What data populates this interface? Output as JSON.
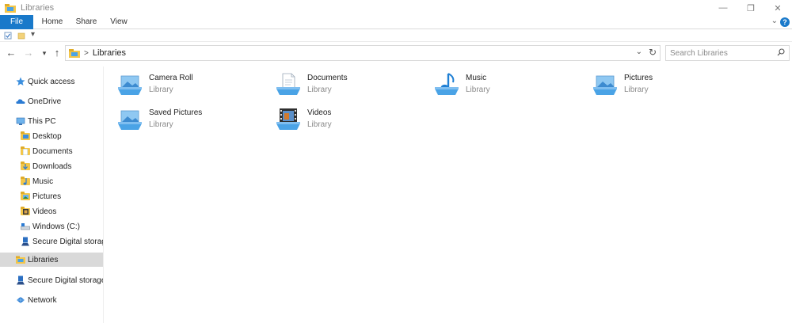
{
  "window": {
    "title": "Libraries"
  },
  "ribbon": {
    "tabs": [
      {
        "label": "File"
      },
      {
        "label": "Home"
      },
      {
        "label": "Share"
      },
      {
        "label": "View"
      }
    ],
    "help_label": "?"
  },
  "address": {
    "crumb": "Libraries",
    "separator": ">"
  },
  "search": {
    "placeholder": "Search Libraries"
  },
  "nav": {
    "items": [
      {
        "label": "Quick access",
        "icon": "star-icon"
      },
      {
        "label": "OneDrive",
        "icon": "cloud-icon"
      },
      {
        "label": "This PC",
        "icon": "computer-icon"
      },
      {
        "label": "Desktop",
        "icon": "desktop-folder-icon"
      },
      {
        "label": "Documents",
        "icon": "documents-folder-icon"
      },
      {
        "label": "Downloads",
        "icon": "downloads-folder-icon"
      },
      {
        "label": "Music",
        "icon": "music-folder-icon"
      },
      {
        "label": "Pictures",
        "icon": "pictures-folder-icon"
      },
      {
        "label": "Videos",
        "icon": "videos-folder-icon"
      },
      {
        "label": "Windows (C:)",
        "icon": "drive-icon"
      },
      {
        "label": "Secure Digital storage",
        "icon": "sd-card-icon"
      },
      {
        "label": "Libraries",
        "icon": "libraries-icon",
        "selected": true
      },
      {
        "label": "Secure Digital storage d",
        "icon": "sd-card-icon"
      },
      {
        "label": "Network",
        "icon": "network-icon"
      }
    ]
  },
  "libraries": [
    {
      "name": "Camera Roll",
      "type": "Library",
      "icon": "pictures-library-icon"
    },
    {
      "name": "Documents",
      "type": "Library",
      "icon": "documents-library-icon"
    },
    {
      "name": "Music",
      "type": "Library",
      "icon": "music-library-icon"
    },
    {
      "name": "Pictures",
      "type": "Library",
      "icon": "pictures-library-icon"
    },
    {
      "name": "Saved Pictures",
      "type": "Library",
      "icon": "pictures-library-icon"
    },
    {
      "name": "Videos",
      "type": "Library",
      "icon": "videos-library-icon"
    }
  ],
  "colors": {
    "accent": "#1979ca",
    "selection": "#d9d9d9",
    "library_tray": "#4aa3e6"
  }
}
